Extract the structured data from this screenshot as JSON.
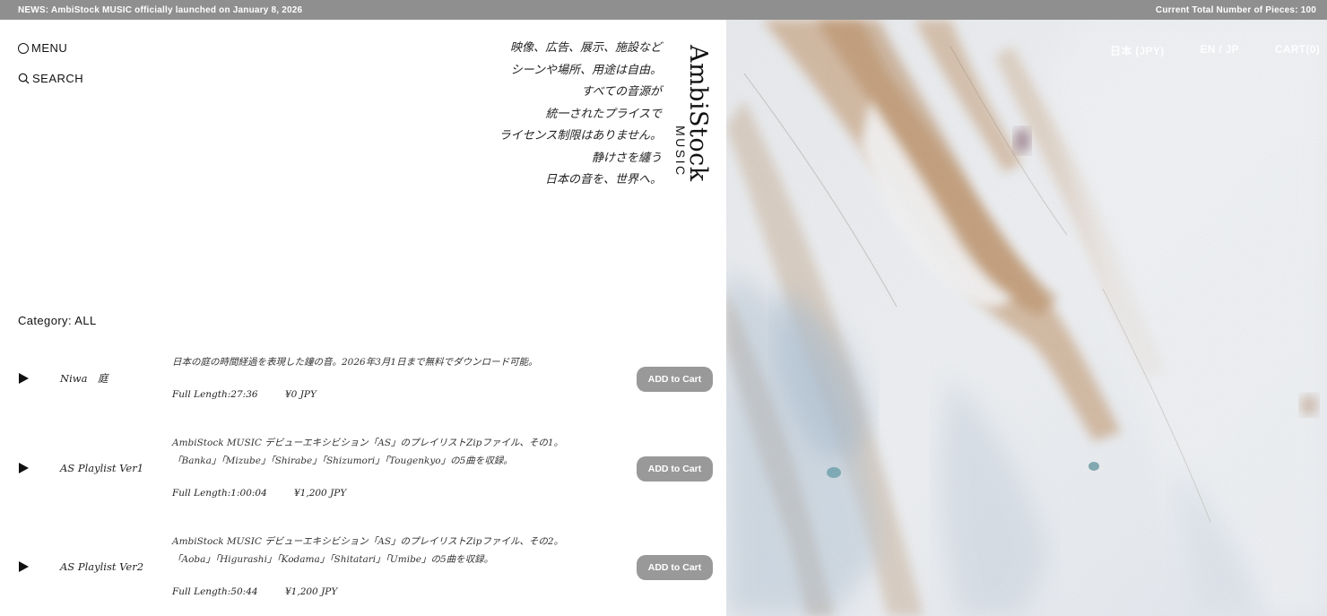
{
  "news": {
    "text": "NEWS: AmbiStock MUSIC officially launched on January 8, 2026",
    "count": "Current Total Number of Pieces: 100"
  },
  "nav": {
    "menu": "MENU",
    "search": "SEARCH",
    "currency": "日本 (JPY)",
    "lang": "EN / JP",
    "cart": "CART(0)"
  },
  "logo": {
    "main": "AmbiStock",
    "sub": "MUSIC"
  },
  "tagline": [
    "映像、広告、展示、施設など",
    "シーンや場所、用途は自由。",
    "すべての音源が",
    "統一されたプライスで",
    "ライセンス制限はありません。",
    "静けさを纏う",
    "日本の音を、世界へ。"
  ],
  "category": "Category: ALL",
  "tracks": [
    {
      "title": "Niwa　庭",
      "desc1": "日本の庭の時間経過を表現した鐘の音。2026年3月1日まで無料でダウンロード可能。",
      "desc2": "",
      "length": "Full Length:27:36",
      "price": "¥0 JPY",
      "button": "ADD to Cart"
    },
    {
      "title": "AS Playlist Ver1",
      "desc1": "AmbiStock MUSIC デビューエキシビション「AS」のプレイリストZipファイル、その1。",
      "desc2": "「Banka」「Mizube」「Shirabe」「Shizumori」「Tougenkyo」の5曲を収録。",
      "length": "Full Length:1:00:04",
      "price": "¥1,200 JPY",
      "button": "ADD to Cart"
    },
    {
      "title": "AS Playlist Ver2",
      "desc1": "AmbiStock MUSIC デビューエキシビション「AS」のプレイリストZipファイル、その2。",
      "desc2": "「Aoba」「Higurashi」「Kodama」「Shitatari」「Umibe」の5曲を収録。",
      "length": "Full Length:50:44",
      "price": "¥1,200 JPY",
      "button": "ADD to Cart"
    }
  ]
}
